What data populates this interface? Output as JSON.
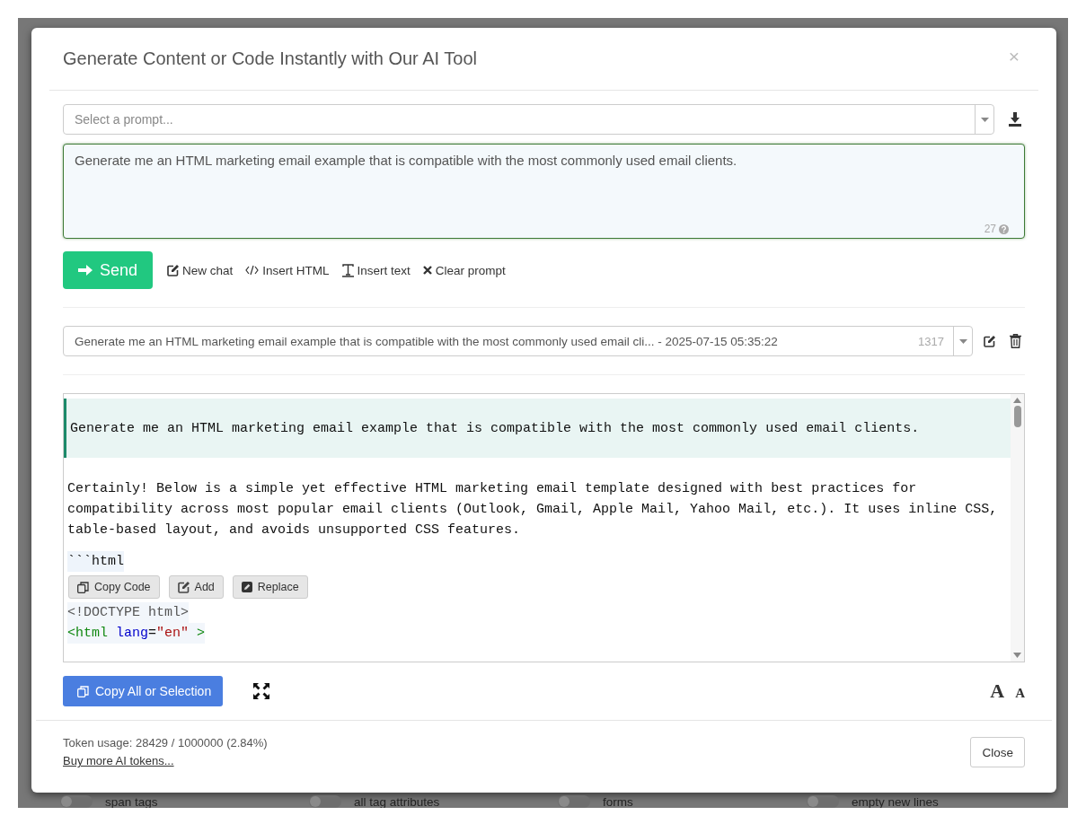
{
  "modal": {
    "title": "Generate Content or Code Instantly with Our AI Tool",
    "close_label": "×"
  },
  "prompt_select": {
    "placeholder": "Select a prompt..."
  },
  "prompt_input": {
    "value": "Generate me an HTML marketing email example that is compatible with the most commonly used email clients.",
    "counter": "27"
  },
  "send_button": "Send",
  "prompt_actions": [
    {
      "label": "New chat"
    },
    {
      "label": "Insert HTML"
    },
    {
      "label": "Insert text"
    },
    {
      "label": "Clear prompt"
    }
  ],
  "history_select": {
    "value": "Generate me an HTML marketing email example that is compatible with the most commonly used email cli... - 2025-07-15 05:35:22",
    "count": "1317"
  },
  "chat": {
    "user_message": "Generate me an HTML marketing email example that is compatible with the most commonly used email clients.",
    "reply": "Certainly! Below is a simple yet effective HTML marketing email template designed with best practices for compatibility across most popular email clients (Outlook, Gmail, Apple Mail, Yahoo Mail, etc.). It uses inline CSS, table-based layout, and avoids unsupported CSS features.",
    "code_fence": "```html",
    "code_buttons": [
      {
        "label": "Copy Code"
      },
      {
        "label": "Add"
      },
      {
        "label": "Replace"
      }
    ],
    "code_lines": [
      {
        "tokens": [
          {
            "kind": "doctype",
            "text": "<!DOCTYPE html>"
          }
        ]
      },
      {
        "tokens": [
          {
            "kind": "tag",
            "text": "<html"
          },
          {
            "kind": "attr",
            "text": " lang"
          },
          {
            "kind": "plain",
            "text": "="
          },
          {
            "kind": "string",
            "text": "\"en\""
          },
          {
            "kind": "tag",
            "text": " >"
          }
        ]
      }
    ]
  },
  "copy_all_button": "Copy All or Selection",
  "font_size_buttons": [
    {
      "label": "A",
      "kind": "larger"
    },
    {
      "label": "A",
      "kind": "smaller"
    }
  ],
  "footer": {
    "token_usage": "Token usage: 28429 / 1000000 (2.84%)",
    "buy_link": "Buy more AI tokens...",
    "close_button": "Close"
  },
  "background_options": [
    {
      "label": "span tags",
      "on": false
    },
    {
      "label": "all tag attributes",
      "on": false
    },
    {
      "label": "forms",
      "on": false
    },
    {
      "label": "empty new lines",
      "on": false
    }
  ]
}
